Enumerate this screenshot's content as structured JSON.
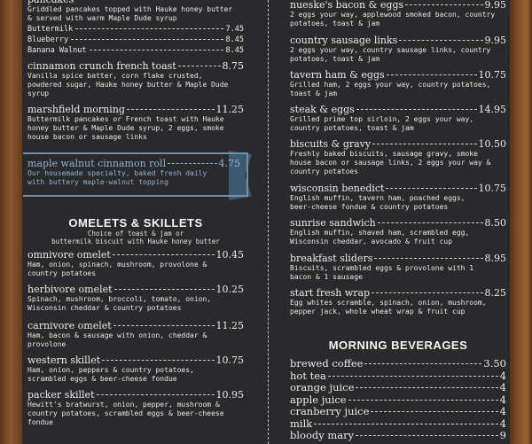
{
  "left": {
    "pancakes": {
      "name": "pancakes",
      "desc": "Griddled pancakes topped with Hauke honey butter\n& served with warm Maple Dude syrup",
      "options": [
        {
          "name": "Buttermilk",
          "price": "7.45"
        },
        {
          "name": "Blueberry",
          "price": "8.45"
        },
        {
          "name": "Banana Walnut",
          "price": "8.45"
        }
      ]
    },
    "items": [
      {
        "name": "cinnamon crunch french toast",
        "price": "8.75",
        "desc": "Vanilla spice batter, corn flake crusted,\npowdered sugar, Hauke honey butter & Maple Dude\nsyrup"
      },
      {
        "name": "marshfield morning",
        "price": "11.25",
        "desc": "Buttermilk pancakes or French toast with Hauke\nhoney butter & Maple Dude syrup, 2 eggs, smoke\nhouse bacon or sausage links"
      }
    ],
    "feature": {
      "name": "maple walnut cinnamon roll",
      "price": "4.75",
      "desc": "Our housemade specialty, baked fresh daily\nwith buttery maple-walnut topping"
    },
    "omelets_heading": "OMELETS & SKILLETS",
    "omelets_sub": "Choice of toast & jam or\nbuttermilk biscuit with Hauke honey butter",
    "omelets": [
      {
        "name": "omnivore omelet",
        "price": "10.45",
        "desc": "Ham, onion, spinach, mushroom, provolone &\ncountry potatoes"
      },
      {
        "name": "herbivore omelet",
        "price": "10.25",
        "desc": "Spinach, mushroom, broccoli, tomato, onion,\nWisconsin cheddar & country potatoes"
      },
      {
        "name": "carnivore omelet",
        "price": "11.25",
        "desc": "Ham, bacon & sausage with onion, cheddar &\nprovolone"
      },
      {
        "name": "western skillet",
        "price": "10.75",
        "desc": "Ham, onion, peppers & country potatoes,\nscrambled eggs & beer-cheese fondue"
      },
      {
        "name": "packer skillet",
        "price": "10.95",
        "desc": "Hewitt's bratwurst, onion, pepper, mushroom &\ncountry potatoes, scrambled eggs & beer-cheese\nfondue"
      }
    ]
  },
  "right": {
    "items": [
      {
        "name": "nueske's bacon & eggs",
        "price": "9.95",
        "desc": "2 eggs your way, applewood smoked bacon, country\npotatoes, toast & jam"
      },
      {
        "name": "country sausage links",
        "price": "9.95",
        "desc": "2 eggs your way, country sausage links, country\npotatoes, toast & jam"
      },
      {
        "name": "tavern ham & eggs",
        "price": "10.75",
        "desc": "Grilled ham, 2 eggs your way, country potatoes,\ntoast & jam"
      },
      {
        "name": "steak & eggs",
        "price": "14.95",
        "desc": "Grilled prime top sirloin, 2 eggs your way,\ncountry potatoes, toast & jam"
      },
      {
        "name": "biscuits & gravy",
        "price": "10.50",
        "desc": "Freshly baked biscuits, sausage gravy, smoke\nhouse bacon or sausage links, 2 eggs your way &\ncountry potatoes"
      },
      {
        "name": "wisconsin benedict",
        "price": "10.75",
        "desc": "English muffin, tavern ham, poached eggs,\nbeer-cheese fondue & country potatoes"
      },
      {
        "name": "sunrise sandwich",
        "price": "8.50",
        "desc": "English muffin, shaved ham, scrambled egg,\nWisconsin cheddar, avocado & fruit cup"
      },
      {
        "name": "breakfast sliders",
        "price": "8.95",
        "desc": "Biscuits, scrambled eggs & provolone with 1\nbacon & 1 sausage"
      },
      {
        "name": "start fresh wrap",
        "price": "8.25",
        "desc": "Egg whites scramble, spinach, onion, mushroom,\npepper jack, whole wheat wrap & fruit cup"
      }
    ],
    "beverages_heading": "MORNING BEVERAGES",
    "beverages": [
      {
        "name": "brewed coffee",
        "price": "3.50"
      },
      {
        "name": "hot tea",
        "price": "4"
      },
      {
        "name": "orange juice",
        "price": "4"
      },
      {
        "name": "apple juice",
        "price": "4"
      },
      {
        "name": "cranberry juice",
        "price": "4"
      },
      {
        "name": "milk",
        "price": "4"
      },
      {
        "name": "bloody mary",
        "price": "9"
      }
    ]
  }
}
